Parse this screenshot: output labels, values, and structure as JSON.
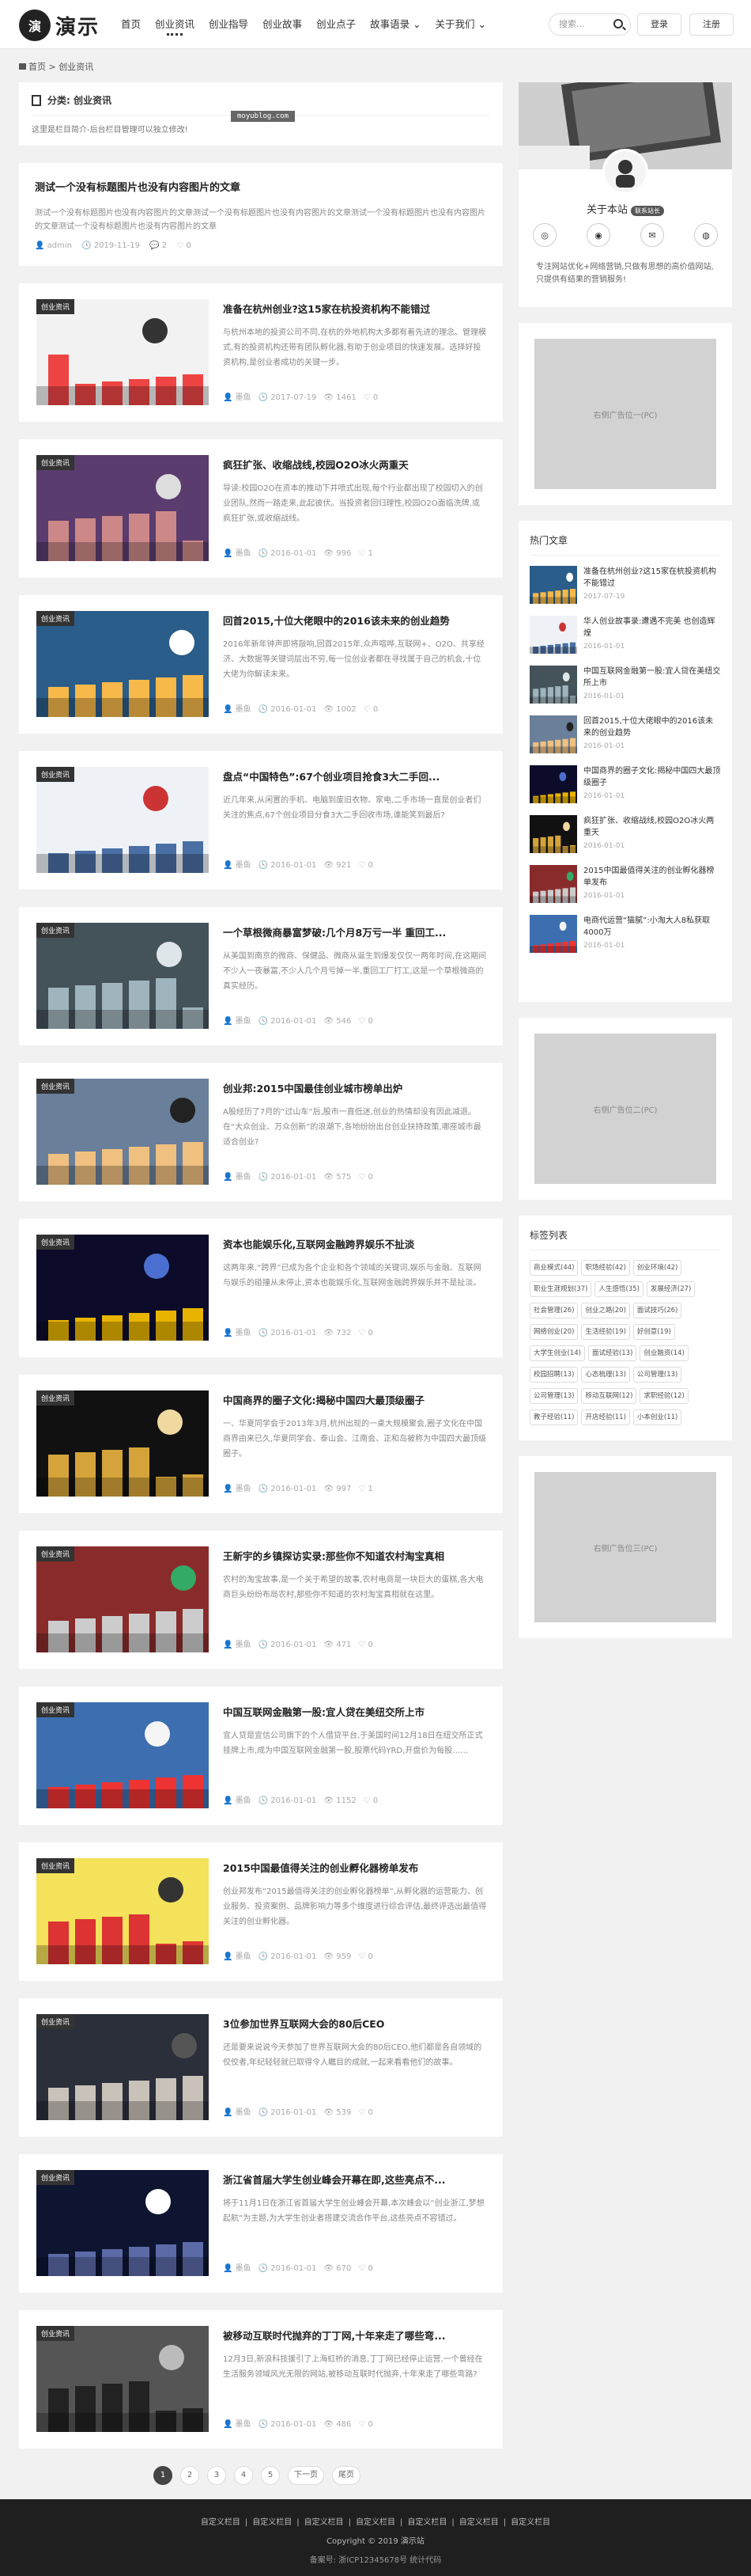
{
  "header": {
    "logo_mark": "演",
    "logo_text": "演示",
    "nav": [
      "首页",
      "创业资讯",
      "创业指导",
      "创业故事",
      "创业点子",
      "故事语录",
      "关于我们"
    ],
    "nav_dropdowns": [
      "故事语录",
      "关于我们"
    ],
    "search_placeholder": "搜索...",
    "login": "登录",
    "register": "注册"
  },
  "breadcrumb": {
    "home": "首页",
    "sep": ">",
    "current": "创业资讯"
  },
  "category": {
    "title": "分类: 创业资讯",
    "desc": "这里是栏目简介-后台栏目管理可以独立修改!",
    "watermark": "moyublog.com"
  },
  "text_post": {
    "title": "测试一个没有标题图片也没有内容图片的文章",
    "summary": "测试一个没有标题图片也没有内容图片的文章测试一个没有标题图片也没有内容图片的文章测试一个没有标题图片也没有内容图片的文章测试一个没有标题图片也没有内容图片的文章",
    "author": "admin",
    "date": "2019-11-19",
    "comments": "2",
    "likes": "0"
  },
  "articles": [
    {
      "tag": "创业资讯",
      "title": "准备在杭州创业?这15家在杭投资机构不能错过",
      "summary": "与杭州本地的投资公司不同,在杭的外地机构大多都有着先进的理念、管理模式,有的投资机构还带有团队孵化器,有助于创业项目的快速发展。选择好投资机构,是创业者成功的关键一步。",
      "author": "墨鱼",
      "date": "2017-07-19",
      "views": "1461",
      "likes": "0"
    },
    {
      "tag": "创业资讯",
      "title": "疯狂扩张、收缩战线,校园O2O冰火两重天",
      "summary": "导读:校园O2O在资本的推动下井喷式出现,每个行业都出现了校园切入的创业团队,然而一路走来,此起彼伏。当投资者回归理性,校园O2O面临洗牌,或疯狂扩张,或收缩战线。",
      "author": "墨鱼",
      "date": "2016-01-01",
      "views": "996",
      "likes": "1"
    },
    {
      "tag": "创业资讯",
      "title": "回首2015,十位大佬眼中的2016该未来的创业趋势",
      "summary": "2016年新年钟声即将敲响,回首2015年,众声喧哗,互联网+、O2O、共享经济、大数据等关键词层出不穷,每一位创业者都在寻找属于自己的机会,十位大佬为你解读未来。",
      "author": "墨鱼",
      "date": "2016-01-01",
      "views": "1002",
      "likes": "0"
    },
    {
      "tag": "创业资讯",
      "title": "盘点“中国特色”:67个创业项目抢食3大二手回...",
      "summary": "近几年来,从闲置的手机、电脑到废旧衣物、家电,二手市场一直是创业者们关注的焦点,67个创业项目分食3大二手回收市场,谁能笑到最后?",
      "author": "墨鱼",
      "date": "2016-01-01",
      "views": "921",
      "likes": "0"
    },
    {
      "tag": "创业资讯",
      "title": "一个草根微商暴富梦破:几个月8万亏一半 重回工...",
      "summary": "从美国到南京的微商、保健品、微商从诞生到爆发仅仅一两年时间,在这期间不少人一夜暴富,不少人几个月亏掉一半,重回工厂打工,这是一个草根微商的真实经历。",
      "author": "墨鱼",
      "date": "2016-01-01",
      "views": "546",
      "likes": "0"
    },
    {
      "tag": "创业资讯",
      "title": "创业邦:2015中国最佳创业城市榜单出炉",
      "summary": "A股经历了7月的“过山车”后,股市一直低迷,创业的热情却没有因此减退。在“大众创业、万众创新”的浪潮下,各地纷纷出台创业扶持政策,哪座城市最适合创业?",
      "author": "墨鱼",
      "date": "2016-01-01",
      "views": "575",
      "likes": "0"
    },
    {
      "tag": "创业资讯",
      "title": "资本也能娱乐化,互联网金融跨界娱乐不扯淡",
      "summary": "这两年来,“跨界”已成为各个企业和各个领域的关键词,娱乐与金融、互联网与娱乐的碰撞从未停止,资本也能娱乐化,互联网金融跨界娱乐并不是扯淡。",
      "author": "墨鱼",
      "date": "2016-01-01",
      "views": "732",
      "likes": "0"
    },
    {
      "tag": "创业资讯",
      "title": "中国商界的圈子文化:揭秘中国四大最顶级圈子",
      "summary": "一、华夏同学会于2013年3月,杭州出现的一桌大规模聚会,圈子文化在中国商界由来已久,华夏同学会、泰山会、江南会、正和岛被称为中国四大最顶级圈子。",
      "author": "墨鱼",
      "date": "2016-01-01",
      "views": "997",
      "likes": "1"
    },
    {
      "tag": "创业资讯",
      "title": "王新宇的乡镇探访实录:那些你不知道农村淘宝真相",
      "summary": "农村的淘宝故事,是一个关于希望的故事,农村电商是一块巨大的蛋糕,各大电商巨头纷纷布局农村,那些你不知道的农村淘宝真相就在这里。",
      "author": "墨鱼",
      "date": "2016-01-01",
      "views": "471",
      "likes": "0"
    },
    {
      "tag": "创业资讯",
      "title": "中国互联网金融第一股:宜人贷在美纽交所上市",
      "summary": "宜人贷是宜信公司旗下的个人借贷平台,于美国时间12月18日在纽交所正式挂牌上市,成为中国互联网金融第一股,股票代码YRD,开盘价为每股……",
      "author": "墨鱼",
      "date": "2016-01-01",
      "views": "1152",
      "likes": "0"
    },
    {
      "tag": "创业资讯",
      "title": "2015中国最值得关注的创业孵化器榜单发布",
      "summary": "创业邦发布“2015最值得关注的创业孵化器榜单”,从孵化器的运营能力、创业服务、投资案例、品牌影响力等多个维度进行综合评估,最终评选出最值得关注的创业孵化器。",
      "author": "墨鱼",
      "date": "2016-01-01",
      "views": "959",
      "likes": "0"
    },
    {
      "tag": "创业资讯",
      "title": "3位参加世界互联网大会的80后CEO",
      "summary": "还是要来说说今天参加了世界互联网大会的80后CEO,他们都是各自领域的佼佼者,年纪轻轻就已取得令人瞩目的成就,一起来看看他们的故事。",
      "author": "墨鱼",
      "date": "2016-01-01",
      "views": "539",
      "likes": "0"
    },
    {
      "tag": "创业资讯",
      "title": "浙江省首届大学生创业峰会开幕在即,这些亮点不...",
      "summary": "将于11月1日在浙江省首届大学生创业峰会开幕,本次峰会以“创业浙江,梦想起航”为主题,为大学生创业者搭建交流合作平台,这些亮点不容错过。",
      "author": "墨鱼",
      "date": "2016-01-01",
      "views": "670",
      "likes": "0"
    },
    {
      "tag": "创业资讯",
      "title": "被移动互联时代抛弃的丁丁网,十年来走了哪些弯...",
      "summary": "12月3日,新浪科技援引了上海虹桥的消息,丁丁网已经停止运营,一个曾经在生活服务领域风光无限的网站,被移动互联时代抛弃,十年来走了哪些弯路?",
      "author": "墨鱼",
      "date": "2016-01-01",
      "views": "486",
      "likes": "0"
    }
  ],
  "pagination": [
    "1",
    "2",
    "3",
    "4",
    "5",
    "下一页",
    "尾页"
  ],
  "sidebar": {
    "about_title": "关于本站",
    "about_badge": "联系站长",
    "about_desc": "专注网站优化+网络营销,只做有思想的高价值网站,只提供有结果的营销服务!",
    "ad1": "右侧广告位一(PC)",
    "ad2": "右侧广告位二(PC)",
    "ad3": "右侧广告位三(PC)",
    "hot_title": "热门文章",
    "hot": [
      {
        "title": "准备在杭州创业?这15家在杭投资机构不能错过",
        "date": "2017-07-19"
      },
      {
        "title": "华人创业故事录:遭遇不完美 也创造辉煌",
        "date": "2016-01-01"
      },
      {
        "title": "中国互联网金融第一股:宜人贷在美纽交所上市",
        "date": "2016-01-01"
      },
      {
        "title": "回首2015,十位大佬眼中的2016该未来的创业趋势",
        "date": "2016-01-01"
      },
      {
        "title": "中国商界的圈子文化:揭秘中国四大最顶级圈子",
        "date": "2016-01-01"
      },
      {
        "title": "疯狂扩张、收缩战线,校园O2O冰火两重天",
        "date": "2016-01-01"
      },
      {
        "title": "2015中国最值得关注的创业孵化器榜单发布",
        "date": "2016-01-01"
      },
      {
        "title": "电商代运营“猫腻”:小淘大人8私获取4000万",
        "date": "2016-01-01"
      }
    ],
    "tags_title": "标签列表",
    "tags": [
      "商业模式(44)",
      "职场经验(42)",
      "创业环境(42)",
      "职业生涯规划(37)",
      "人生感悟(35)",
      "发展经济(27)",
      "社会管理(26)",
      "创业之路(20)",
      "面试技巧(26)",
      "网络创业(20)",
      "生活经验(19)",
      "好创意(19)",
      "大学生创业(14)",
      "面试经验(13)",
      "创业融资(14)",
      "校园招聘(13)",
      "心态梳理(13)",
      "公司管理(13)",
      "公司管理(13)",
      "移动互联网(12)",
      "求职经验(12)",
      "教子经验(11)",
      "开店经验(11)",
      "小本创业(11)"
    ]
  },
  "footer": {
    "links": [
      "自定义栏目",
      "自定义栏目",
      "自定义栏目",
      "自定义栏目",
      "自定义栏目",
      "自定义栏目",
      "自定义栏目"
    ],
    "copyright": "Copyright © 2019 演示站",
    "icp": "备案号: 浙ICP12345678号 统计代码"
  }
}
